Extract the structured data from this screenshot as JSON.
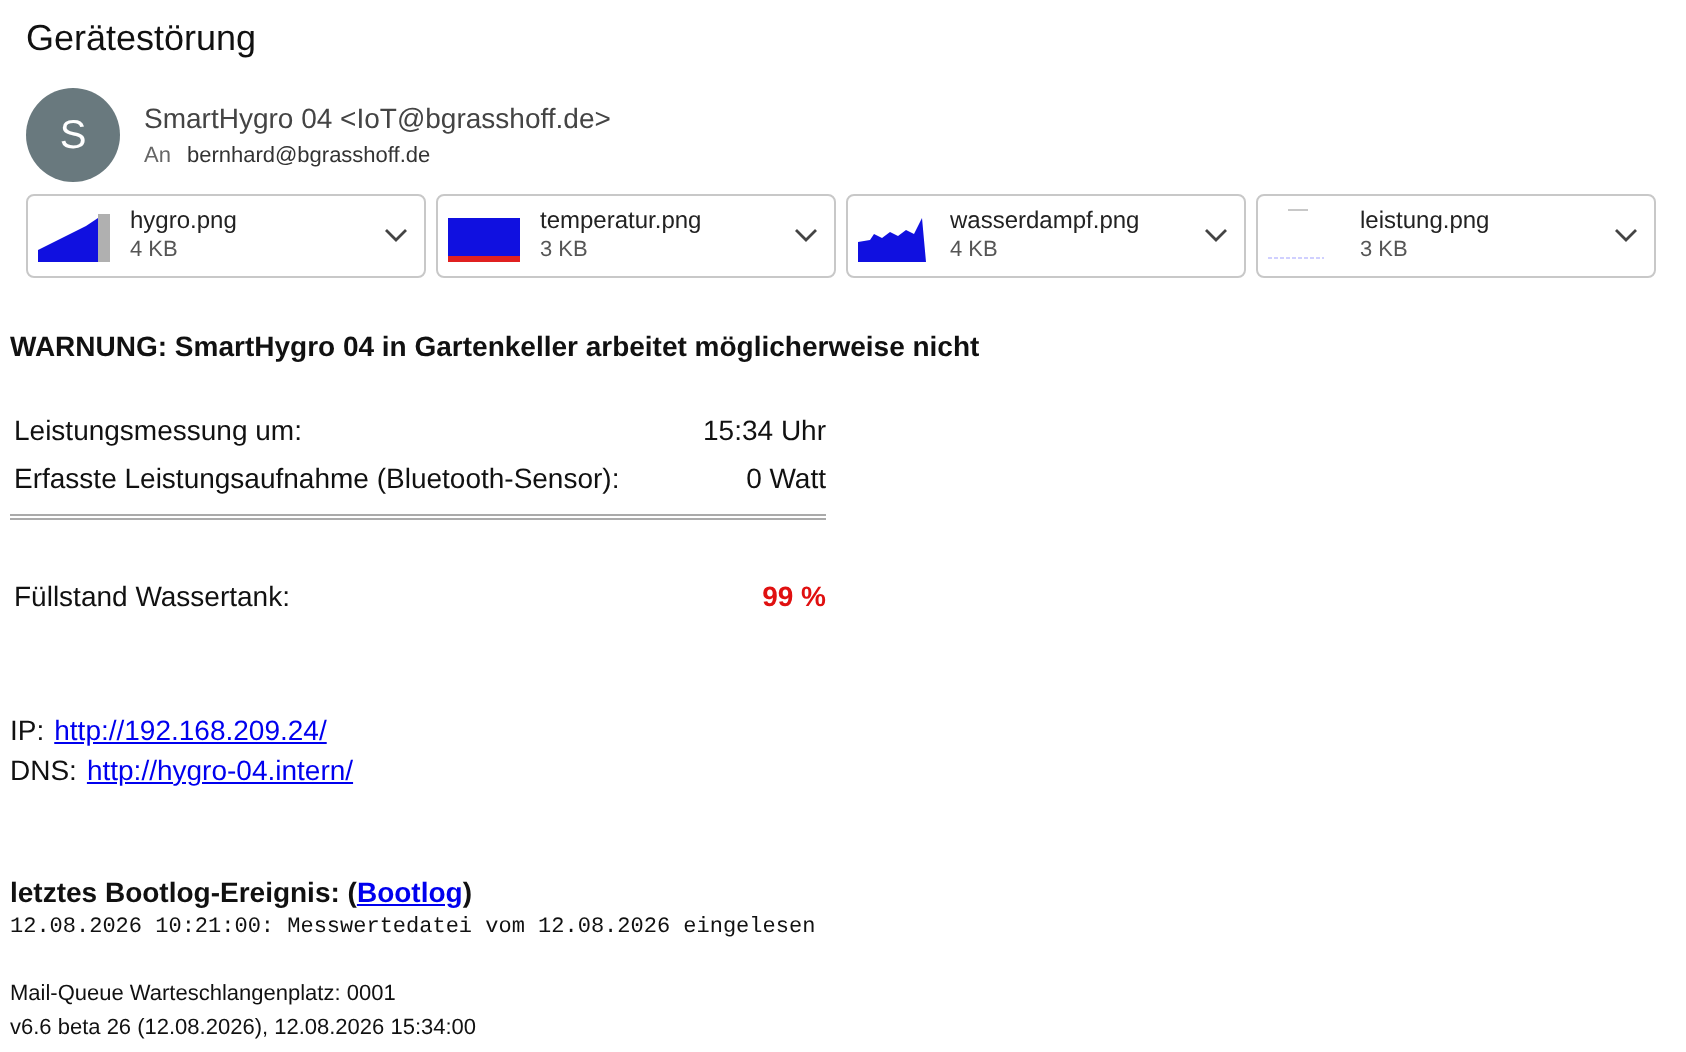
{
  "subject": "Gerätestörung",
  "sender": {
    "avatar_letter": "S",
    "from": "SmartHygro 04 <IoT@bgrasshoff.de>",
    "to_label": "An",
    "to": "bernhard@bgrasshoff.de"
  },
  "attachments": [
    {
      "name": "hygro.png",
      "size": "4 KB",
      "kind": "area"
    },
    {
      "name": "temperatur.png",
      "size": "3 KB",
      "kind": "block"
    },
    {
      "name": "wasserdampf.png",
      "size": "4 KB",
      "kind": "spiky"
    },
    {
      "name": "leistung.png",
      "size": "3 KB",
      "kind": "blank"
    }
  ],
  "warning": "WARNUNG: SmartHygro 04 in Gartenkeller arbeitet möglicherweise nicht",
  "measurements": [
    {
      "label": "Leistungsmessung um:",
      "value": "15:34 Uhr"
    },
    {
      "label": "Erfasste Leistungsaufnahme (Bluetooth-Sensor):",
      "value": "0 Watt"
    }
  ],
  "tank": {
    "label": "Füllstand Wassertank:",
    "value": "99 %",
    "alert": true
  },
  "links": [
    {
      "label": "IP:",
      "url": "http://192.168.209.24/"
    },
    {
      "label": "DNS:",
      "url": "http://hygro-04.intern/"
    }
  ],
  "bootlog": {
    "heading_before": "letztes Bootlog-Ereignis: (",
    "link": "Bootlog",
    "heading_after": ")",
    "entry": "12.08.2026 10:21:00: Messwertedatei vom 12.08.2026 eingelesen"
  },
  "footer": [
    "Mail-Queue Warteschlangenplatz: 0001",
    "v6.6 beta 26 (12.08.2026), 12.08.2026 15:34:00"
  ]
}
